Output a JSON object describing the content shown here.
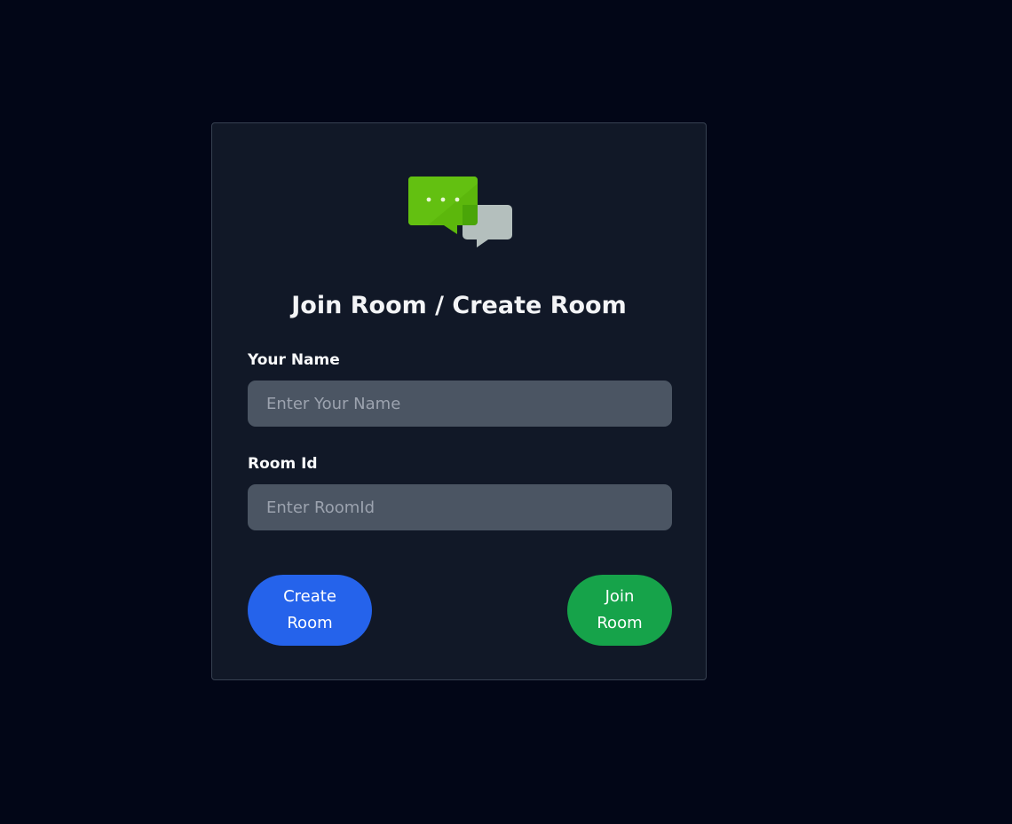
{
  "app": {
    "title": "Join Room / Create Room",
    "logo_icon": "chat-bubbles-icon"
  },
  "form": {
    "name_label": "Your Name",
    "name_placeholder": "Enter Your Name",
    "name_value": "",
    "room_label": "Room Id",
    "room_placeholder": "Enter RoomId",
    "room_value": ""
  },
  "buttons": {
    "create_line1": "Create",
    "create_line2": "Room",
    "join_line1": "Join",
    "join_line2": "Room"
  },
  "colors": {
    "page_bg": "#020617",
    "card_bg": "#111827",
    "input_bg": "#4b5563",
    "create_button": "#2563eb",
    "join_button": "#16a34a",
    "logo_green": "#5cb70c",
    "logo_gray": "#b4bfbd"
  }
}
